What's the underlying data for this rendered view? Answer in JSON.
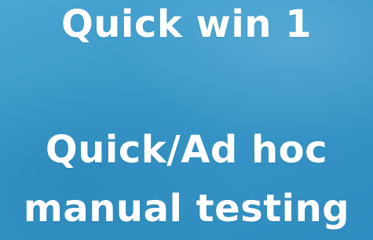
{
  "slide": {
    "heading": "Quick win 1",
    "body_lines": [
      "Quick/Ad hoc",
      "manual testing"
    ]
  },
  "colors": {
    "background": "#3a99c9",
    "text": "#ffffff"
  }
}
